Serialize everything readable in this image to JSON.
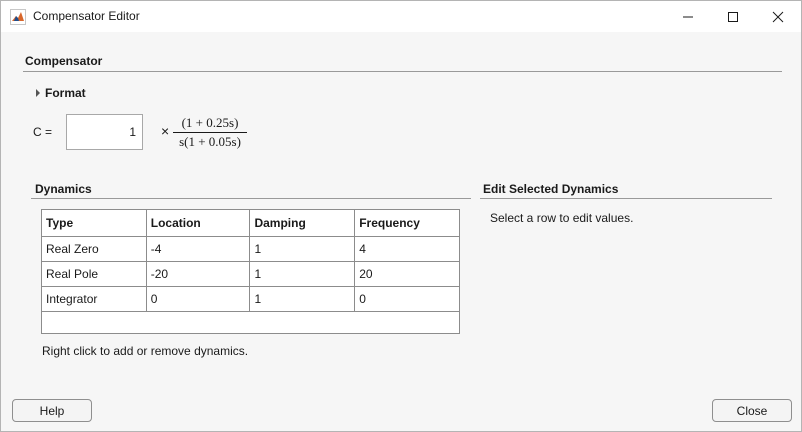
{
  "window": {
    "title": "Compensator Editor"
  },
  "compensator": {
    "heading": "Compensator",
    "format_label": "Format",
    "c_label": "C =",
    "gain_value": "1",
    "times_symbol": "×",
    "numerator": "(1 + 0.25s)",
    "denominator": "s(1 + 0.05s)"
  },
  "dynamics": {
    "heading": "Dynamics",
    "columns": [
      "Type",
      "Location",
      "Damping",
      "Frequency"
    ],
    "rows": [
      [
        "Real Zero",
        "-4",
        "1",
        "4"
      ],
      [
        "Real Pole",
        "-20",
        "1",
        "20"
      ],
      [
        "Integrator",
        "0",
        "1",
        "0"
      ]
    ],
    "hint": "Right click to add or remove dynamics."
  },
  "edit_selected": {
    "heading": "Edit Selected Dynamics",
    "message": "Select a row to edit values."
  },
  "buttons": {
    "help": "Help",
    "close": "Close"
  },
  "icons": {
    "app": "matlab-icon",
    "minimize": "minimize-icon",
    "maximize": "maximize-icon",
    "close": "close-icon"
  },
  "colors": {
    "accent": "#c8501e"
  }
}
